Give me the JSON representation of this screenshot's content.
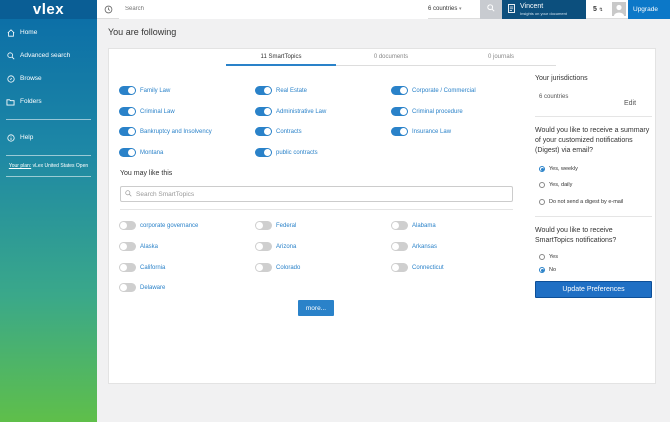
{
  "sidebar": {
    "logo": "vlex",
    "items": [
      {
        "label": "Home",
        "icon": "home-icon"
      },
      {
        "label": "Advanced search",
        "icon": "search-icon"
      },
      {
        "label": "Browse",
        "icon": "compass-icon"
      },
      {
        "label": "Folders",
        "icon": "folder-icon"
      },
      {
        "label": "Help",
        "icon": "info-icon"
      }
    ],
    "plan_link": "Your plan:",
    "plan_text": "vLex United States Open"
  },
  "topbar": {
    "search_placeholder": "Search",
    "countries": "6 countries",
    "user_name": "Vincent",
    "user_sub": "Insights on your document",
    "vincent_count": "5",
    "upgrade": "Upgrade"
  },
  "page": {
    "title": "You are following",
    "tabs": [
      "11 SmartTopics",
      "0 documents",
      "0 journals"
    ]
  },
  "followed_topics": [
    "Family Law",
    "Real Estate",
    "Corporate / Commercial",
    "Criminal Law",
    "Administrative Law",
    "Criminal procedure",
    "Bankruptcy and Insolvency",
    "Contracts",
    "Insurance Law",
    "Montana",
    "public contracts"
  ],
  "suggestions": {
    "title": "You may like this",
    "search_placeholder": "Search SmartTopics",
    "topics": [
      "corporate governance",
      "Federal",
      "Alabama",
      "Alaska",
      "Arizona",
      "Arkansas",
      "California",
      "Colorado",
      "Connecticut",
      "Delaware"
    ],
    "more_label": "more..."
  },
  "right_panel": {
    "jurisdictions_title": "Your jurisdictions",
    "jurisdictions_value": "6 countries",
    "edit_label": "Edit",
    "digest_question": "Would you like to receive a summary of your customized notifications (Digest) via email?",
    "digest_options": [
      "Yes, weekly",
      "Yes, daily",
      "Do not send a digest by e-mail"
    ],
    "digest_selected": "Yes, weekly",
    "notif_question": "Would you like to receive SmartTopics notifications?",
    "notif_options": [
      "Yes",
      "No"
    ],
    "notif_selected": "No",
    "update_label": "Update Preferences"
  },
  "colors": {
    "accent": "#2a82c9",
    "sidebar_top": "#0a6ca7",
    "sidebar_bottom": "#5fbf4a",
    "user_bg": "#0c4f7d"
  }
}
